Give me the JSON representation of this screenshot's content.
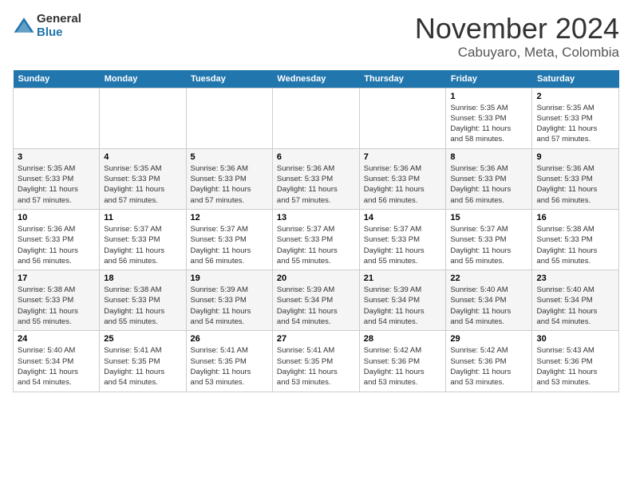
{
  "header": {
    "logo_general": "General",
    "logo_blue": "Blue",
    "month_title": "November 2024",
    "location": "Cabuyaro, Meta, Colombia"
  },
  "weekdays": [
    "Sunday",
    "Monday",
    "Tuesday",
    "Wednesday",
    "Thursday",
    "Friday",
    "Saturday"
  ],
  "weeks": [
    [
      {
        "day": "",
        "info": ""
      },
      {
        "day": "",
        "info": ""
      },
      {
        "day": "",
        "info": ""
      },
      {
        "day": "",
        "info": ""
      },
      {
        "day": "",
        "info": ""
      },
      {
        "day": "1",
        "info": "Sunrise: 5:35 AM\nSunset: 5:33 PM\nDaylight: 11 hours\nand 58 minutes."
      },
      {
        "day": "2",
        "info": "Sunrise: 5:35 AM\nSunset: 5:33 PM\nDaylight: 11 hours\nand 57 minutes."
      }
    ],
    [
      {
        "day": "3",
        "info": "Sunrise: 5:35 AM\nSunset: 5:33 PM\nDaylight: 11 hours\nand 57 minutes."
      },
      {
        "day": "4",
        "info": "Sunrise: 5:35 AM\nSunset: 5:33 PM\nDaylight: 11 hours\nand 57 minutes."
      },
      {
        "day": "5",
        "info": "Sunrise: 5:36 AM\nSunset: 5:33 PM\nDaylight: 11 hours\nand 57 minutes."
      },
      {
        "day": "6",
        "info": "Sunrise: 5:36 AM\nSunset: 5:33 PM\nDaylight: 11 hours\nand 57 minutes."
      },
      {
        "day": "7",
        "info": "Sunrise: 5:36 AM\nSunset: 5:33 PM\nDaylight: 11 hours\nand 56 minutes."
      },
      {
        "day": "8",
        "info": "Sunrise: 5:36 AM\nSunset: 5:33 PM\nDaylight: 11 hours\nand 56 minutes."
      },
      {
        "day": "9",
        "info": "Sunrise: 5:36 AM\nSunset: 5:33 PM\nDaylight: 11 hours\nand 56 minutes."
      }
    ],
    [
      {
        "day": "10",
        "info": "Sunrise: 5:36 AM\nSunset: 5:33 PM\nDaylight: 11 hours\nand 56 minutes."
      },
      {
        "day": "11",
        "info": "Sunrise: 5:37 AM\nSunset: 5:33 PM\nDaylight: 11 hours\nand 56 minutes."
      },
      {
        "day": "12",
        "info": "Sunrise: 5:37 AM\nSunset: 5:33 PM\nDaylight: 11 hours\nand 56 minutes."
      },
      {
        "day": "13",
        "info": "Sunrise: 5:37 AM\nSunset: 5:33 PM\nDaylight: 11 hours\nand 55 minutes."
      },
      {
        "day": "14",
        "info": "Sunrise: 5:37 AM\nSunset: 5:33 PM\nDaylight: 11 hours\nand 55 minutes."
      },
      {
        "day": "15",
        "info": "Sunrise: 5:37 AM\nSunset: 5:33 PM\nDaylight: 11 hours\nand 55 minutes."
      },
      {
        "day": "16",
        "info": "Sunrise: 5:38 AM\nSunset: 5:33 PM\nDaylight: 11 hours\nand 55 minutes."
      }
    ],
    [
      {
        "day": "17",
        "info": "Sunrise: 5:38 AM\nSunset: 5:33 PM\nDaylight: 11 hours\nand 55 minutes."
      },
      {
        "day": "18",
        "info": "Sunrise: 5:38 AM\nSunset: 5:33 PM\nDaylight: 11 hours\nand 55 minutes."
      },
      {
        "day": "19",
        "info": "Sunrise: 5:39 AM\nSunset: 5:33 PM\nDaylight: 11 hours\nand 54 minutes."
      },
      {
        "day": "20",
        "info": "Sunrise: 5:39 AM\nSunset: 5:34 PM\nDaylight: 11 hours\nand 54 minutes."
      },
      {
        "day": "21",
        "info": "Sunrise: 5:39 AM\nSunset: 5:34 PM\nDaylight: 11 hours\nand 54 minutes."
      },
      {
        "day": "22",
        "info": "Sunrise: 5:40 AM\nSunset: 5:34 PM\nDaylight: 11 hours\nand 54 minutes."
      },
      {
        "day": "23",
        "info": "Sunrise: 5:40 AM\nSunset: 5:34 PM\nDaylight: 11 hours\nand 54 minutes."
      }
    ],
    [
      {
        "day": "24",
        "info": "Sunrise: 5:40 AM\nSunset: 5:34 PM\nDaylight: 11 hours\nand 54 minutes."
      },
      {
        "day": "25",
        "info": "Sunrise: 5:41 AM\nSunset: 5:35 PM\nDaylight: 11 hours\nand 54 minutes."
      },
      {
        "day": "26",
        "info": "Sunrise: 5:41 AM\nSunset: 5:35 PM\nDaylight: 11 hours\nand 53 minutes."
      },
      {
        "day": "27",
        "info": "Sunrise: 5:41 AM\nSunset: 5:35 PM\nDaylight: 11 hours\nand 53 minutes."
      },
      {
        "day": "28",
        "info": "Sunrise: 5:42 AM\nSunset: 5:36 PM\nDaylight: 11 hours\nand 53 minutes."
      },
      {
        "day": "29",
        "info": "Sunrise: 5:42 AM\nSunset: 5:36 PM\nDaylight: 11 hours\nand 53 minutes."
      },
      {
        "day": "30",
        "info": "Sunrise: 5:43 AM\nSunset: 5:36 PM\nDaylight: 11 hours\nand 53 minutes."
      }
    ]
  ]
}
